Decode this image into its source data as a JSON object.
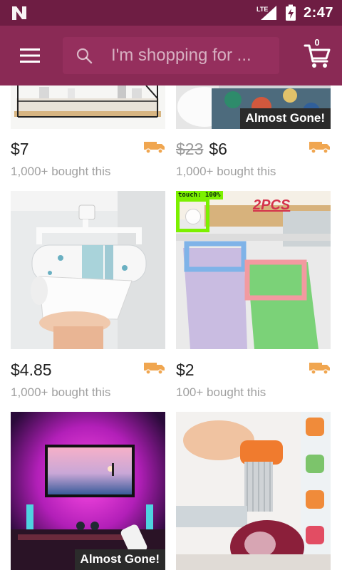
{
  "status_bar": {
    "time": "2:47",
    "network_label": "LTE",
    "icons": [
      "n-logo-icon",
      "lte-signal-icon",
      "battery-charging-icon"
    ]
  },
  "app_bar": {
    "menu_icon": "hamburger-menu-icon",
    "search": {
      "placeholder": "I'm shopping for ...",
      "icon": "search-icon"
    },
    "cart": {
      "icon": "cart-icon",
      "count": "0"
    }
  },
  "products": [
    {
      "price": "$7",
      "old_price": "",
      "bought": "1,000+ bought this",
      "badge": ""
    },
    {
      "price": "$6",
      "old_price": "$23",
      "bought": "1,000+ bought this",
      "badge": "Almost Gone!"
    },
    {
      "price": "$4.85",
      "old_price": "",
      "bought": "1,000+ bought this",
      "badge": ""
    },
    {
      "price": "$2",
      "old_price": "",
      "bought": "100+ bought this",
      "badge": "",
      "image_text": "2PCS"
    },
    {
      "price": "",
      "old_price": "",
      "bought": "",
      "badge": "Almost Gone!"
    },
    {
      "price": "",
      "old_price": "",
      "bought": "",
      "badge": ""
    }
  ],
  "overlay": {
    "touch_label": "touch: 100%"
  },
  "colors": {
    "status_bar": "#6e1d43",
    "app_bar": "#8a2a55",
    "search_field": "#952f5d",
    "shipping_truck": "#f0a650",
    "badge_bg": "#2b2b2b",
    "touch_overlay": "#7cf000"
  }
}
